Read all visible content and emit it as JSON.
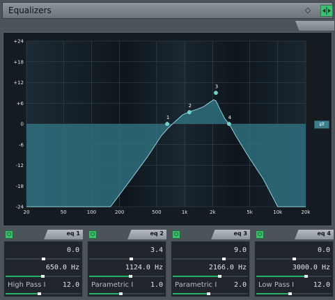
{
  "window": {
    "title": "Equalizers",
    "icons": {
      "diamond": "diamond-icon",
      "ab": "ab-compare-icon"
    }
  },
  "graph": {
    "y_ticks": [
      "+24",
      "+18",
      "+12",
      "+6",
      "0",
      "-6",
      "-12",
      "-18",
      "-24"
    ],
    "x_ticks": [
      "20",
      "50",
      "100",
      "200",
      "500",
      "1k",
      "2k",
      "5k",
      "10k",
      "20k"
    ],
    "x_tick_values": [
      20,
      50,
      100,
      200,
      500,
      1000,
      2000,
      5000,
      10000,
      20000
    ],
    "y_tick_values": [
      24,
      18,
      12,
      6,
      0,
      -6,
      -12,
      -18,
      -24
    ],
    "link_icon": "link-icon",
    "nodes": [
      {
        "label": "1",
        "freq": 650,
        "gain": 0.0
      },
      {
        "label": "2",
        "freq": 1124,
        "gain": 3.4
      },
      {
        "label": "3",
        "freq": 2166,
        "gain": 9.0
      },
      {
        "label": "4",
        "freq": 3000,
        "gain": 0.0
      }
    ],
    "curve": [
      [
        20,
        -24
      ],
      [
        160,
        -24
      ],
      [
        250,
        -17
      ],
      [
        400,
        -9.5
      ],
      [
        560,
        -3.5
      ],
      [
        650,
        -1.5
      ],
      [
        800,
        0.8
      ],
      [
        950,
        2.6
      ],
      [
        1124,
        3.5
      ],
      [
        1350,
        4.2
      ],
      [
        1600,
        5.0
      ],
      [
        1850,
        6.2
      ],
      [
        2050,
        7.0
      ],
      [
        2166,
        6.7
      ],
      [
        2400,
        4.2
      ],
      [
        2700,
        1.5
      ],
      [
        3000,
        0
      ],
      [
        3600,
        -3.8
      ],
      [
        5000,
        -10
      ],
      [
        7000,
        -16
      ],
      [
        10000,
        -24
      ],
      [
        20000,
        -24
      ]
    ]
  },
  "modules": [
    {
      "name": "eq 1",
      "gain": "0.0",
      "freq": "650.0 Hz",
      "type": "High Pass I",
      "q": "12.0",
      "gain_pos": 0.5,
      "freq_pos": 0.49,
      "q_pos": 0.44
    },
    {
      "name": "eq 2",
      "gain": "3.4",
      "freq": "1124.0 Hz",
      "type": "Parametric I",
      "q": "1.0",
      "gain_pos": 0.56,
      "freq_pos": 0.55,
      "q_pos": 0.42
    },
    {
      "name": "eq 3",
      "gain": "9.0",
      "freq": "2166.0 Hz",
      "type": "Parametric I",
      "q": "2.0",
      "gain_pos": 0.68,
      "freq_pos": 0.62,
      "q_pos": 0.47
    },
    {
      "name": "eq 4",
      "gain": "0.0",
      "freq": "3000.0 Hz",
      "type": "Low Pass I",
      "q": "12.0",
      "gain_pos": 0.5,
      "freq_pos": 0.66,
      "q_pos": 0.44
    }
  ]
}
